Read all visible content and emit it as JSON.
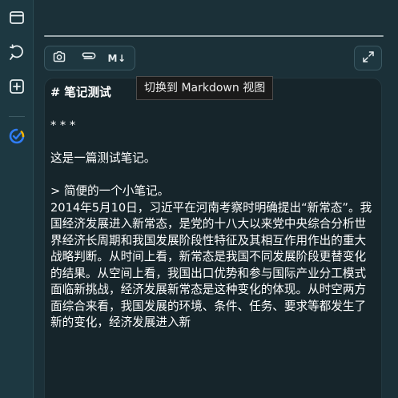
{
  "sidebar": {
    "items": [
      {
        "icon": "window-icon",
        "name": "sidebar-window-button"
      },
      {
        "icon": "refresh-chat-icon",
        "name": "sidebar-chat-button"
      },
      {
        "icon": "plus-square-icon",
        "name": "sidebar-add-button"
      },
      {
        "icon": "check-circle-icon",
        "name": "sidebar-task-button"
      }
    ],
    "accent_color": "#2f7df6",
    "accent_color_2": "#f4b400"
  },
  "toolbar": {
    "buttons": [
      {
        "icon": "camera-icon"
      },
      {
        "icon": "paperclip-icon"
      },
      {
        "icon": "markdown-icon",
        "label": "M↓"
      }
    ]
  },
  "tooltip": {
    "text": "切换到 Markdown 视图"
  },
  "editor": {
    "lines": [
      "# 笔记测试",
      "",
      "* * *",
      "",
      "这是一篇测试笔记。",
      "",
      "> 简便的一个小笔记。",
      "2014年5月10日，习近平在河南考察时明确提出“新常态”。我国经济发展进入新常态，是党的十八大以来党中央综合分析世界经济长周期和我国发展阶段性特征及其相互作用作出的重大战略判断。从时间上看，新常态是我国不同发展阶段更替变化的结果。从空间上看，我国出口优势和参与国际产业分工模式面临新挑战，经济发展新常态是这种变化的体现。从时空两方面综合来看，我国发展的环境、条件、任务、要求等都发生了新的变化，经济发展进入新"
    ]
  }
}
